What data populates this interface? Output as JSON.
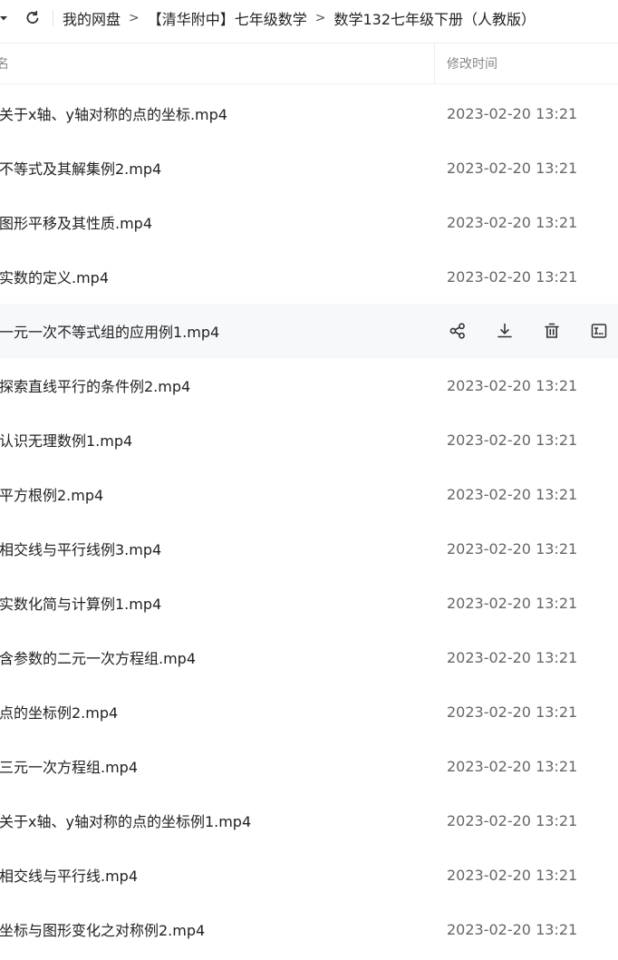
{
  "toolbar": {
    "breadcrumb": [
      "我的网盘",
      "【清华附中】七年级数学",
      "数学132七年级下册（人教版）"
    ],
    "separator": ">"
  },
  "list_header": {
    "name_label": "名",
    "time_label": "修改时间"
  },
  "files": [
    {
      "name": "关于x轴、y轴对称的点的坐标.mp4",
      "time": "2023-02-20 13:21"
    },
    {
      "name": "不等式及其解集例2.mp4",
      "time": "2023-02-20 13:21"
    },
    {
      "name": "图形平移及其性质.mp4",
      "time": "2023-02-20 13:21"
    },
    {
      "name": "实数的定义.mp4",
      "time": "2023-02-20 13:21"
    },
    {
      "name": "一元一次不等式组的应用例1.mp4",
      "time": "2023-02-20 13:21"
    },
    {
      "name": "探索直线平行的条件例2.mp4",
      "time": "2023-02-20 13:21"
    },
    {
      "name": "认识无理数例1.mp4",
      "time": "2023-02-20 13:21"
    },
    {
      "name": "平方根例2.mp4",
      "time": "2023-02-20 13:21"
    },
    {
      "name": "相交线与平行线例3.mp4",
      "time": "2023-02-20 13:21"
    },
    {
      "name": "实数化简与计算例1.mp4",
      "time": "2023-02-20 13:21"
    },
    {
      "name": "含参数的二元一次方程组.mp4",
      "time": "2023-02-20 13:21"
    },
    {
      "name": "点的坐标例2.mp4",
      "time": "2023-02-20 13:21"
    },
    {
      "name": "三元一次方程组.mp4",
      "time": "2023-02-20 13:21"
    },
    {
      "name": "关于x轴、y轴对称的点的坐标例1.mp4",
      "time": "2023-02-20 13:21"
    },
    {
      "name": "相交线与平行线.mp4",
      "time": "2023-02-20 13:21"
    },
    {
      "name": "坐标与图形变化之对称例2.mp4",
      "time": "2023-02-20 13:21"
    }
  ],
  "hovered_index": 4,
  "row_actions": [
    "share-icon",
    "download-icon",
    "delete-icon",
    "rename-icon"
  ]
}
